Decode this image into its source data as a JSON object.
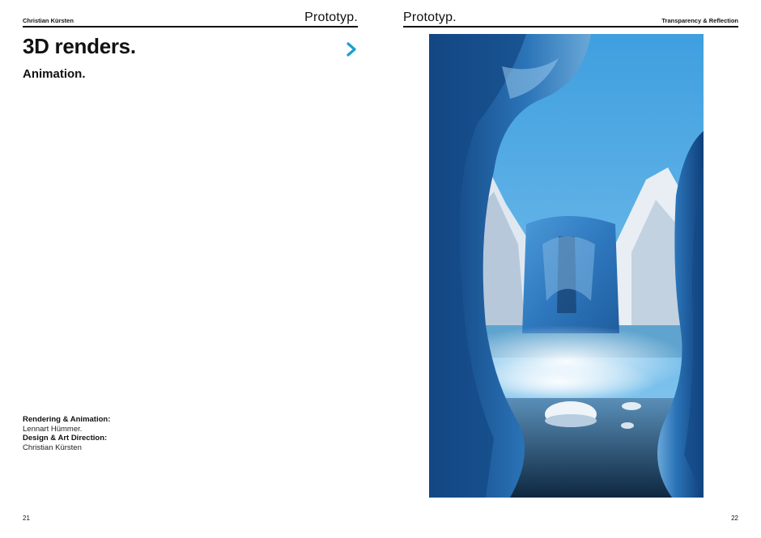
{
  "left_page": {
    "author": "Christian Kürsten",
    "brand": "Prototyp.",
    "title": "3D renders.",
    "subtitle": "Animation.",
    "next_icon": "chevron-right-icon",
    "credits": [
      {
        "label": "Rendering & Animation:",
        "value": "Lennart Hümmer."
      },
      {
        "label": "Design & Art Direction:",
        "value": "Christian Kürsten"
      }
    ],
    "page_number": "21"
  },
  "right_page": {
    "brand": "Prototyp.",
    "section": "Transparency & Reflection",
    "page_number": "22"
  },
  "colors": {
    "accent": "#1b9fcf",
    "text": "#111111",
    "sky": "#45a8e2",
    "ice": "#2f73b5"
  }
}
